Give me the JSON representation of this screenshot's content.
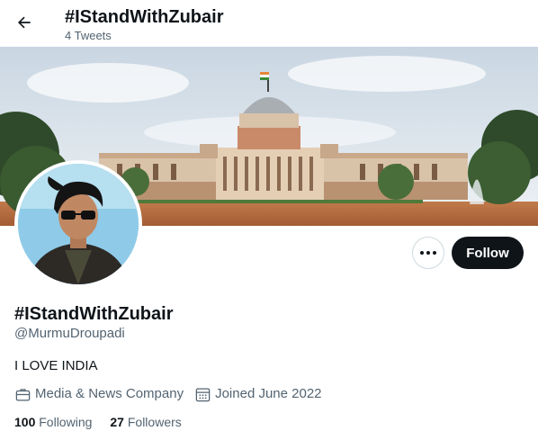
{
  "header": {
    "title": "#IStandWithZubair",
    "subtitle": "4 Tweets"
  },
  "profile": {
    "display_name": "#IStandWithZubair",
    "handle": "@MurmuDroupadi",
    "bio": "I LOVE INDIA",
    "category": "Media & News Company",
    "joined": "Joined June 2022",
    "following_count": "100",
    "following_label": "Following",
    "followers_count": "27",
    "followers_label": "Followers"
  },
  "actions": {
    "follow_label": "Follow"
  },
  "icons": {
    "back": "arrow-left-icon",
    "more": "more-dots-icon",
    "category": "briefcase-icon",
    "joined": "calendar-icon"
  },
  "colors": {
    "text_primary": "#0f1419",
    "text_secondary": "#536471",
    "follow_button_bg": "#0f1419",
    "border": "#cfd9de"
  }
}
